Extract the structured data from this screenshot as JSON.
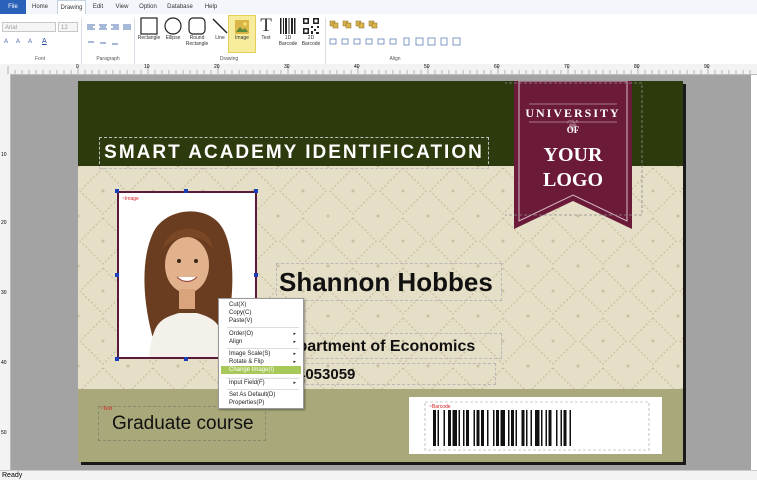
{
  "tabs": [
    {
      "id": "file",
      "label": "File"
    },
    {
      "id": "home",
      "label": "Home"
    },
    {
      "id": "drawing",
      "label": "Drawing"
    },
    {
      "id": "edit",
      "label": "Edit"
    },
    {
      "id": "view",
      "label": "View"
    },
    {
      "id": "option",
      "label": "Option"
    },
    {
      "id": "database",
      "label": "Database"
    },
    {
      "id": "help",
      "label": "Help"
    }
  ],
  "ribbon": {
    "font_name": "Arial",
    "font_size": "12",
    "groups": {
      "font": "Font",
      "paragraph": "Paragraph",
      "drawing": "Drawing",
      "align": "Align"
    },
    "tools": {
      "rectangle": "Rectangle",
      "ellipse": "Ellipse",
      "round_rect_1": "Round",
      "round_rect_2": "Rectangle",
      "line": "Line",
      "image": "Image",
      "text": "Text",
      "bc1d_1": "1D",
      "bc1d_2": "Barcode",
      "bc2d_1": "2D",
      "bc2d_2": "Barcode"
    }
  },
  "rulers": {
    "h_labels": [
      "0",
      "10",
      "20",
      "30",
      "40",
      "50",
      "60",
      "70",
      "80",
      "90"
    ],
    "v_labels": [
      "10",
      "20",
      "30",
      "40",
      "50"
    ]
  },
  "card": {
    "title": "SMART ACADEMY IDENTIFICATION",
    "logo_line1": "UNIVERSITY",
    "logo_line2": "OF",
    "logo_line3": "YOUR",
    "logo_line4": "LOGO",
    "image_tag": "~Image",
    "text_tag": "~Text",
    "name": "Shannon Hobbes",
    "department": "Department of Economics",
    "id_number": "4053059",
    "course": "Graduate course",
    "barcode_tag": "~Barcode"
  },
  "context_menu": {
    "cut": "Cut(X)",
    "copy": "Copy(C)",
    "paste": "Paste(V)",
    "order": "Order(O)",
    "align": "Align",
    "image_scale": "Image Scale(S)",
    "rotate_flip": "Rotate & Flip",
    "change_image": "Change Image(I)",
    "input_field": "Input Field(F)",
    "set_default": "Set As Default(D)",
    "properties": "Properties(P)"
  },
  "status": "Ready",
  "colors": {
    "card_top": "#2d3a0d",
    "card_pattern": "#e6dfc7",
    "card_bottom": "#a8a87a",
    "logo_banner": "#6b1a3a",
    "menu_highlight": "#a8c85a",
    "file_tab": "#2b62b9"
  }
}
